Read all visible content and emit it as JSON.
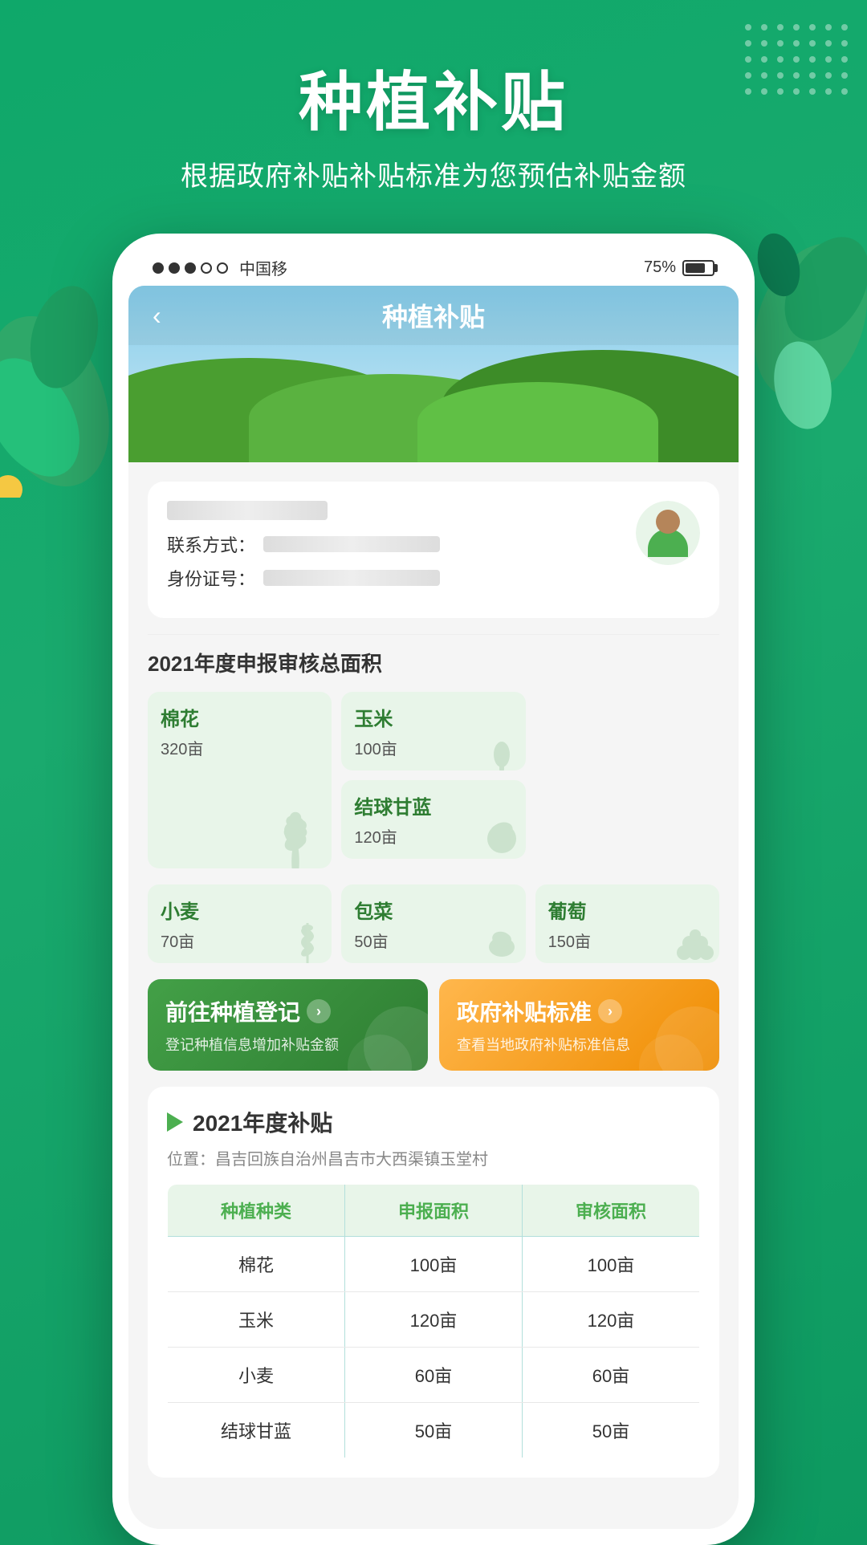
{
  "app": {
    "title": "种植补贴",
    "subtitle": "根据政府补贴补贴标准为您预估补贴金额",
    "back_label": "‹"
  },
  "status_bar": {
    "carrier": "中国移",
    "battery_percent": "75%",
    "signals": [
      "●",
      "●",
      "●",
      "○",
      "○"
    ]
  },
  "user": {
    "contact_label": "联系方式：",
    "id_label": "身份证号："
  },
  "year_section": {
    "title": "2021年度申报审核总面积"
  },
  "crops": [
    {
      "name": "棉花",
      "area": "320亩",
      "large": true
    },
    {
      "name": "玉米",
      "area": "100亩",
      "large": false
    },
    {
      "name": "结球甘蓝",
      "area": "120亩",
      "large": false
    },
    {
      "name": "小麦",
      "area": "70亩",
      "large": false
    },
    {
      "name": "包菜",
      "area": "50亩",
      "large": false
    },
    {
      "name": "葡萄",
      "area": "150亩",
      "large": false
    }
  ],
  "action_buttons": [
    {
      "id": "planting_register",
      "title": "前往种植登记",
      "desc": "登记种植信息增加补贴金额",
      "color": "green"
    },
    {
      "id": "gov_standard",
      "title": "政府补贴标准",
      "desc": "查看当地政府补贴标准信息",
      "color": "orange"
    }
  ],
  "subsidy": {
    "year_title": "2021年度补贴",
    "location_label": "位置：",
    "location_value": "昌吉回族自治州昌吉市大西渠镇玉堂村",
    "table_headers": [
      "种植种类",
      "申报面积",
      "审核面积"
    ],
    "table_rows": [
      {
        "crop": "棉花",
        "declared": "100亩",
        "verified": "100亩"
      },
      {
        "crop": "玉米",
        "declared": "120亩",
        "verified": "120亩"
      },
      {
        "crop": "小麦",
        "declared": "60亩",
        "verified": "60亩"
      },
      {
        "crop": "结球甘蓝",
        "declared": "50亩",
        "verified": "50亩"
      }
    ]
  },
  "colors": {
    "primary_green": "#1aaa6e",
    "dark_green": "#2e7d32",
    "light_green": "#e8f5e9",
    "orange": "#ef8c00",
    "text_dark": "#333333",
    "text_gray": "#888888"
  }
}
